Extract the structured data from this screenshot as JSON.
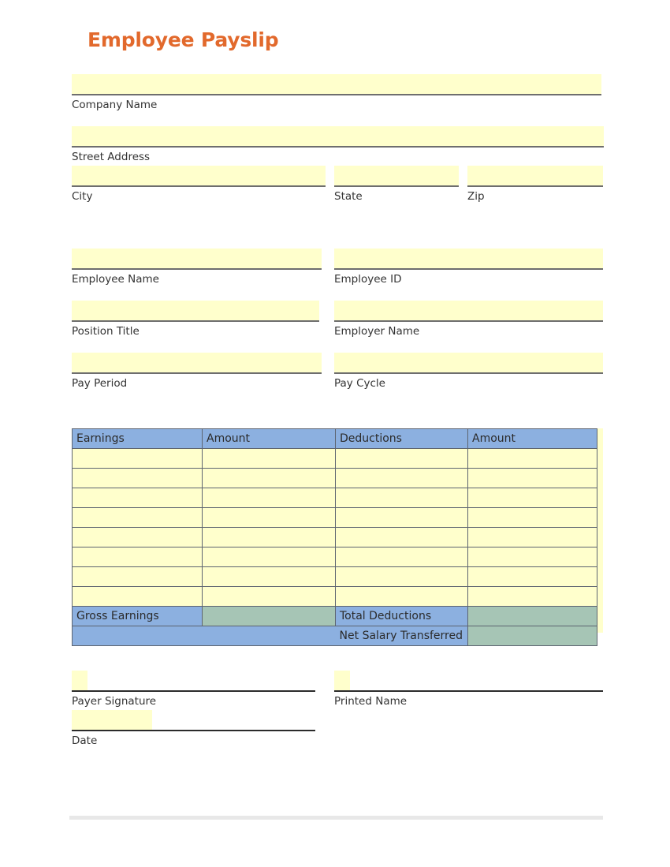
{
  "document": {
    "title": "Employee Payslip",
    "title_color": "#e2692c"
  },
  "colors": {
    "field_fill": "#ffffcc",
    "field_underline": "#6e6e6e",
    "signature_underline": "#2b2b2b",
    "table_header_blue": "#8cb0e0",
    "table_total_green": "#a6c5b5",
    "table_border": "#5d6470",
    "bottom_rule": "#e8e8e8"
  },
  "company_section": {
    "company_name_label": "Company Name",
    "company_name_value": "",
    "street_address_label": "Street Address",
    "street_address_value": "",
    "city_label": "City",
    "city_value": "",
    "state_label": "State",
    "state_value": "",
    "zip_label": "Zip",
    "zip_value": ""
  },
  "employee_section": {
    "employee_name_label": "Employee Name",
    "employee_name_value": "",
    "employee_id_label": "Employee ID",
    "employee_id_value": "",
    "position_title_label": "Position Title",
    "position_title_value": "",
    "employer_name_label": "Employer Name",
    "employer_name_value": "",
    "pay_period_label": "Pay Period",
    "pay_period_value": "",
    "pay_cycle_label": "Pay Cycle",
    "pay_cycle_value": ""
  },
  "pay_table": {
    "headers": [
      "Earnings",
      "Amount",
      "Deductions",
      "Amount"
    ],
    "rows": [
      [
        "",
        "",
        "",
        ""
      ],
      [
        "",
        "",
        "",
        ""
      ],
      [
        "",
        "",
        "",
        ""
      ],
      [
        "",
        "",
        "",
        ""
      ],
      [
        "",
        "",
        "",
        ""
      ],
      [
        "",
        "",
        "",
        ""
      ],
      [
        "",
        "",
        "",
        ""
      ],
      [
        "",
        "",
        "",
        ""
      ]
    ],
    "totals_row": {
      "gross_earnings_label": "Gross Earnings",
      "gross_earnings_value": "",
      "total_deductions_label": "Total Deductions",
      "total_deductions_value": ""
    },
    "net_row": {
      "net_salary_label": "Net Salary Transferred",
      "net_salary_value": ""
    }
  },
  "signature_section": {
    "payer_signature_label": "Payer Signature",
    "payer_signature_value": "",
    "printed_name_label": "Printed Name",
    "printed_name_value": "",
    "date_label": "Date",
    "date_value": ""
  }
}
